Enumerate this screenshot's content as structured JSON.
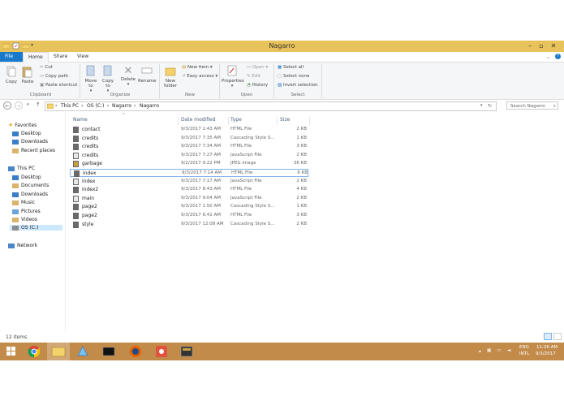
{
  "window": {
    "title": "Nagarro"
  },
  "tabs": {
    "file": "File",
    "home": "Home",
    "share": "Share",
    "view": "View"
  },
  "ribbon": {
    "copy": "Copy",
    "paste": "Paste",
    "cut": "Cut",
    "copy_path": "Copy path",
    "paste_shortcut": "Paste shortcut",
    "move_to": "Move to",
    "copy_to": "Copy to",
    "delete": "Delete",
    "rename": "Rename",
    "new_folder": "New folder",
    "new_item": "New item",
    "easy_access": "Easy access",
    "properties": "Properties",
    "open": "Open",
    "edit": "Edit",
    "history": "History",
    "select_all": "Select all",
    "select_none": "Select none",
    "invert_selection": "Invert selection",
    "groups": {
      "clipboard": "Clipboard",
      "organize": "Organize",
      "new": "New",
      "open": "Open",
      "select": "Select"
    }
  },
  "address": {
    "crumbs": [
      "This PC",
      "OS (C:)",
      "Nagarro",
      "Nagarro"
    ],
    "search_placeholder": "Search Nagarro"
  },
  "nav": {
    "favorites": "Favorites",
    "fav_items": [
      "Desktop",
      "Downloads",
      "Recent places"
    ],
    "this_pc": "This PC",
    "pc_items": [
      "Desktop",
      "Documents",
      "Downloads",
      "Music",
      "Pictures",
      "Videos",
      "OS (C:)"
    ],
    "network": "Network"
  },
  "columns": {
    "name": "Name",
    "date": "Date modified",
    "type": "Type",
    "size": "Size"
  },
  "files": [
    {
      "name": "contact",
      "date": "9/3/2017 1:43 AM",
      "type": "HTML File",
      "size": "2 KB",
      "icon": "html-file-icon"
    },
    {
      "name": "credits",
      "date": "9/3/2017 7:35 AM",
      "type": "Cascading Style S...",
      "size": "1 KB",
      "icon": "css-file-icon"
    },
    {
      "name": "credits",
      "date": "9/3/2017 7:34 AM",
      "type": "HTML File",
      "size": "3 KB",
      "icon": "html-file-icon"
    },
    {
      "name": "credits",
      "date": "9/3/2017 7:27 AM",
      "type": "JavaScript File",
      "size": "2 KB",
      "icon": "js-file-icon"
    },
    {
      "name": "garbage",
      "date": "9/2/2017 9:22 PM",
      "type": "JPEG image",
      "size": "36 KB",
      "icon": "image-file-icon"
    },
    {
      "name": "index",
      "date": "9/3/2017 7:14 AM",
      "type": "HTML File",
      "size": "6 KB",
      "icon": "html-file-icon"
    },
    {
      "name": "index",
      "date": "9/3/2017 7:17 AM",
      "type": "JavaScript File",
      "size": "2 KB",
      "icon": "js-file-icon"
    },
    {
      "name": "index2",
      "date": "9/3/2017 8:43 AM",
      "type": "HTML File",
      "size": "4 KB",
      "icon": "html-file-icon"
    },
    {
      "name": "main",
      "date": "9/3/2017 9:04 AM",
      "type": "JavaScript File",
      "size": "2 KB",
      "icon": "js-file-icon"
    },
    {
      "name": "page2",
      "date": "9/3/2017 1:50 AM",
      "type": "Cascading Style S...",
      "size": "1 KB",
      "icon": "css-file-icon"
    },
    {
      "name": "page2",
      "date": "9/3/2017 6:41 AM",
      "type": "HTML File",
      "size": "3 KB",
      "icon": "html-file-icon"
    },
    {
      "name": "style",
      "date": "9/3/2017 12:08 AM",
      "type": "Cascading Style S...",
      "size": "2 KB",
      "icon": "css-file-icon"
    }
  ],
  "status": {
    "count": "12 items"
  },
  "tray": {
    "lang": "ENG",
    "region": "INTL",
    "time": "11:26 AM",
    "date": "9/3/2017"
  }
}
